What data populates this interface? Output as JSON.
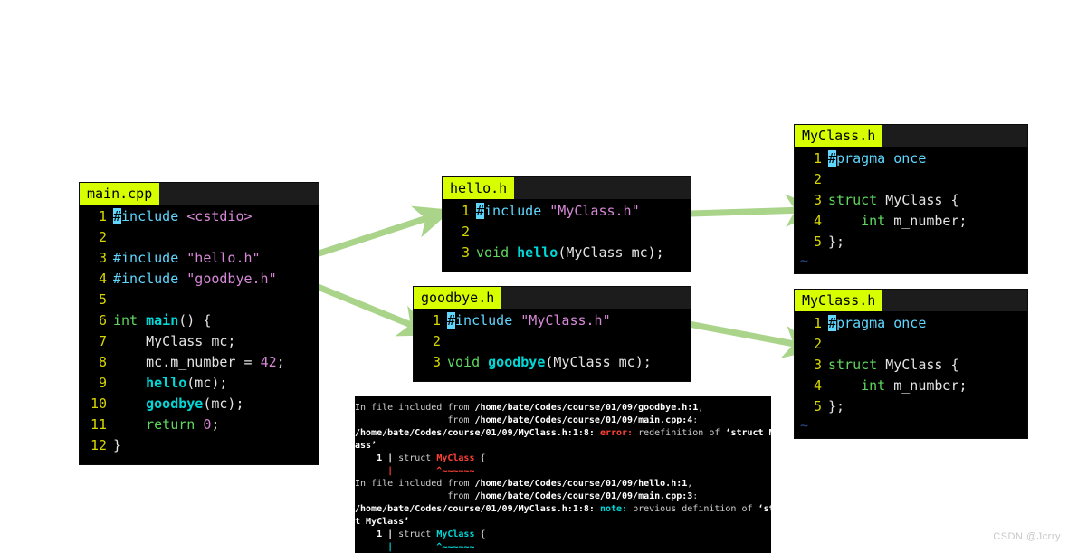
{
  "theme": {
    "page_background": "#ffffff",
    "panel_background": "#000000",
    "titlebar_background": "#1c1c1c",
    "tab_background": "#d7ff00",
    "tab_text": "#000000",
    "line_number_color": "#d7d700",
    "arrow_color": "#a9d48a",
    "keyword_color": "#5fd7ff",
    "string_color": "#d787d7",
    "type_color": "#5fd75f",
    "function_color": "#00d7d7",
    "error_color": "#ff4136",
    "note_color": "#00d7d7",
    "tilde_color": "#2b4a8b"
  },
  "panels": {
    "main_cpp": {
      "tab_label": "main.cpp",
      "lines": [
        {
          "n": "1",
          "text": "#include <cstdio>"
        },
        {
          "n": "2",
          "text": ""
        },
        {
          "n": "3",
          "text": "#include \"hello.h\""
        },
        {
          "n": "4",
          "text": "#include \"goodbye.h\""
        },
        {
          "n": "5",
          "text": ""
        },
        {
          "n": "6",
          "text": "int main() {"
        },
        {
          "n": "7",
          "text": "    MyClass mc;"
        },
        {
          "n": "8",
          "text": "    mc.m_number = 42;"
        },
        {
          "n": "9",
          "text": "    hello(mc);"
        },
        {
          "n": "10",
          "text": "    goodbye(mc);"
        },
        {
          "n": "11",
          "text": "    return 0;"
        },
        {
          "n": "12",
          "text": "}"
        }
      ]
    },
    "hello_h": {
      "tab_label": "hello.h",
      "lines": [
        {
          "n": "1",
          "text": "#include \"MyClass.h\""
        },
        {
          "n": "2",
          "text": ""
        },
        {
          "n": "3",
          "text": "void hello(MyClass mc);"
        }
      ]
    },
    "goodbye_h": {
      "tab_label": "goodbye.h",
      "lines": [
        {
          "n": "1",
          "text": "#include \"MyClass.h\""
        },
        {
          "n": "2",
          "text": ""
        },
        {
          "n": "3",
          "text": "void goodbye(MyClass mc);"
        }
      ]
    },
    "myclass_h_top": {
      "tab_label": "MyClass.h",
      "tilde": "~",
      "lines": [
        {
          "n": "1",
          "text": "#pragma once"
        },
        {
          "n": "2",
          "text": ""
        },
        {
          "n": "3",
          "text": "struct MyClass {"
        },
        {
          "n": "4",
          "text": "    int m_number;"
        },
        {
          "n": "5",
          "text": "};"
        }
      ]
    },
    "myclass_h_bottom": {
      "tab_label": "MyClass.h",
      "tilde": "~",
      "lines": [
        {
          "n": "1",
          "text": "#pragma once"
        },
        {
          "n": "2",
          "text": ""
        },
        {
          "n": "3",
          "text": "struct MyClass {"
        },
        {
          "n": "4",
          "text": "    int m_number;"
        },
        {
          "n": "5",
          "text": "};"
        }
      ]
    }
  },
  "terminal": {
    "lines": [
      {
        "id": "t0",
        "plain_prefix": "In file included from ",
        "bold": "/home/bate/Codes/course/01/09/goodbye.h:1",
        "suffix": ","
      },
      {
        "id": "t1",
        "plain_prefix": "                 from ",
        "bold": "/home/bate/Codes/course/01/09/main.cpp:4",
        "suffix": ":"
      },
      {
        "id": "t2",
        "bold_path": "/home/bate/Codes/course/01/09/MyClass.h:1:8:",
        "severity": "error:",
        "message": " redefinition of ",
        "quoted": "‘struct MyCl"
      },
      {
        "id": "t3",
        "wrap": "ass’"
      },
      {
        "id": "t4",
        "linenum": "    1 | ",
        "code_pre": "struct ",
        "code_id": "MyClass",
        "code_post": " {"
      },
      {
        "id": "t5",
        "caret": "      |        ^~~~~~~"
      },
      {
        "id": "t6",
        "plain_prefix": "In file included from ",
        "bold": "/home/bate/Codes/course/01/09/hello.h:1",
        "suffix": ","
      },
      {
        "id": "t7",
        "plain_prefix": "                 from ",
        "bold": "/home/bate/Codes/course/01/09/main.cpp:3",
        "suffix": ":"
      },
      {
        "id": "t8",
        "bold_path": "/home/bate/Codes/course/01/09/MyClass.h:1:8:",
        "severity": "note:",
        "message": " previous definition of ",
        "quoted": "‘struc"
      },
      {
        "id": "t9",
        "wrap": "t MyClass’"
      },
      {
        "id": "t10",
        "linenum": "    1 | ",
        "code_pre": "struct ",
        "code_id": "MyClass",
        "code_post": " {"
      },
      {
        "id": "t11",
        "caret": "      |        ^~~~~~~"
      }
    ]
  },
  "arrows": [
    {
      "name": "main-to-hello",
      "from": "main.cpp line 3",
      "to": "hello.h"
    },
    {
      "name": "main-to-goodbye",
      "from": "main.cpp line 4",
      "to": "goodbye.h"
    },
    {
      "name": "hello-to-myclass",
      "from": "hello.h line 1",
      "to": "MyClass.h (top)"
    },
    {
      "name": "goodbye-to-myclass",
      "from": "goodbye.h line 1",
      "to": "MyClass.h (bottom)"
    }
  ],
  "watermark": {
    "text": "CSDN @Jcrry"
  }
}
